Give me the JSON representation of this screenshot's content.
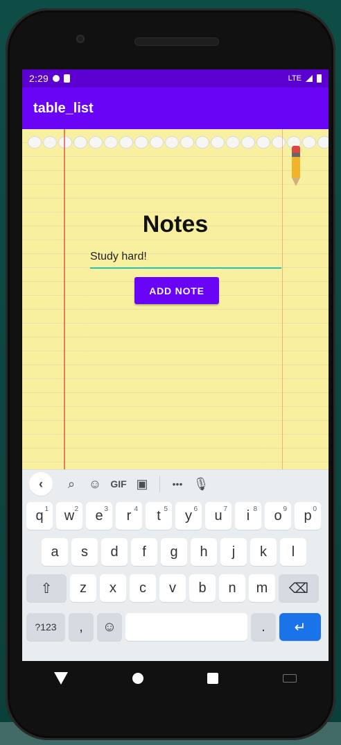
{
  "status": {
    "time": "2:29",
    "network": "LTE"
  },
  "app": {
    "title": "table_list"
  },
  "notes": {
    "heading": "Notes",
    "input_value": "Study hard!",
    "add_button": "ADD NOTE"
  },
  "keyboard": {
    "toolbar": {
      "gif": "GIF",
      "more": "•••"
    },
    "row1": [
      {
        "k": "q",
        "n": "1"
      },
      {
        "k": "w",
        "n": "2"
      },
      {
        "k": "e",
        "n": "3"
      },
      {
        "k": "r",
        "n": "4"
      },
      {
        "k": "t",
        "n": "5"
      },
      {
        "k": "y",
        "n": "6"
      },
      {
        "k": "u",
        "n": "7"
      },
      {
        "k": "i",
        "n": "8"
      },
      {
        "k": "o",
        "n": "9"
      },
      {
        "k": "p",
        "n": "0"
      }
    ],
    "row2": [
      "a",
      "s",
      "d",
      "f",
      "g",
      "h",
      "j",
      "k",
      "l"
    ],
    "row3": [
      "z",
      "x",
      "c",
      "v",
      "b",
      "n",
      "m"
    ],
    "bottom": {
      "symbols": "?123",
      "comma": ",",
      "period": "."
    }
  },
  "colors": {
    "statusbar": "#5a00cf",
    "appbar": "#6a04f7",
    "accent": "#19c6b5",
    "paper": "#f8ef9f"
  }
}
